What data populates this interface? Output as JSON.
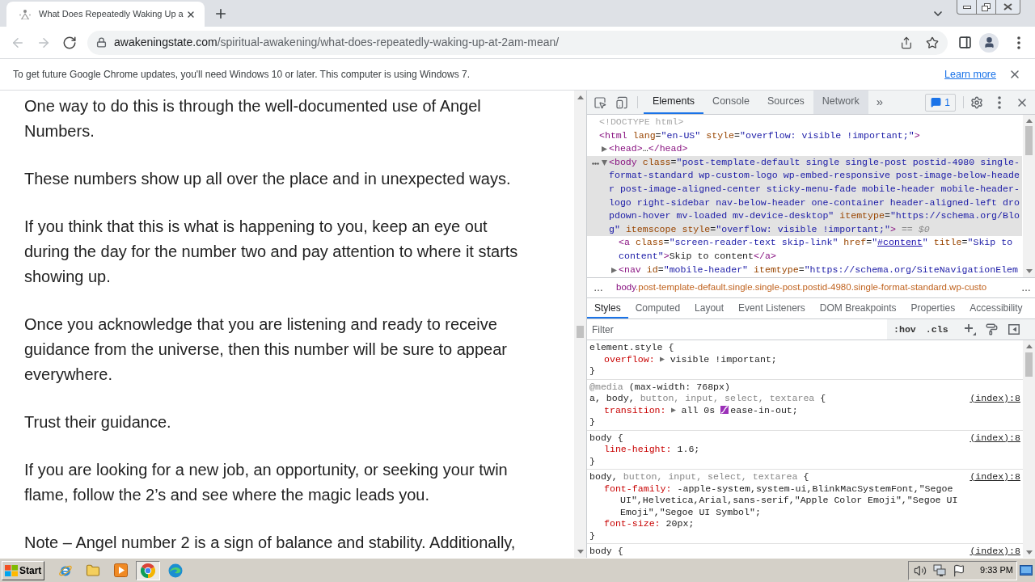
{
  "browser": {
    "tabs": [
      {
        "title": "What Does Repeatedly Waking Up a",
        "selected": true
      }
    ],
    "nav_buttons": [
      {
        "kind": "back",
        "disabled": true
      },
      {
        "kind": "forward",
        "disabled": true
      },
      {
        "kind": "reload",
        "disabled": false
      }
    ],
    "address": {
      "host": "awakeningstate.com",
      "path": "/spiritual-awakening/what-does-repeatedly-waking-up-at-2am-mean/"
    },
    "infobar": {
      "message": "To get future Google Chrome updates, you'll need Windows 10 or later. This computer is using Windows 7.",
      "link": "Learn more"
    }
  },
  "page": {
    "paragraphs": [
      "One way to do this is through the well-documented use of Angel Numbers.",
      "These numbers show up all over the place and in unexpected ways.",
      "If you think that this is what is happening to you, keep an eye out during the day for the number two and pay attention to where it starts showing up.",
      "Once you acknowledge that you are listening and ready to receive guidance from the universe, then this number will be sure to appear everywhere.",
      "Trust their guidance.",
      "If you are looking for a new job, an opportunity, or seeking your twin flame, follow the 2’s and see where the magic leads you.",
      "Note – Angel number 2 is a sign of balance and stability. Additionally,"
    ]
  },
  "devtools": {
    "tabs": [
      {
        "label": "Elements",
        "selected": true,
        "highlighted": false
      },
      {
        "label": "Console",
        "selected": false,
        "highlighted": false
      },
      {
        "label": "Sources",
        "selected": false,
        "highlighted": false
      },
      {
        "label": "Network",
        "selected": false,
        "highlighted": true
      }
    ],
    "more_tabs": "»",
    "issues_count": "1",
    "dom_tree": [
      {
        "segments": [
          {
            "kind": "muted",
            "text": "<!DOCTYPE html>"
          }
        ],
        "selected": false
      },
      {
        "segments": [
          {
            "kind": "tag",
            "text": "<html"
          },
          {
            "kind": "attr",
            "text": " lang"
          },
          {
            "kind": "punct",
            "text": "="
          },
          {
            "kind": "value",
            "text": "\"en-US\""
          },
          {
            "kind": "attr",
            "text": " style"
          },
          {
            "kind": "punct",
            "text": "="
          },
          {
            "kind": "value",
            "text": "\"overflow: visible !important;\""
          },
          {
            "kind": "tag",
            "text": ">"
          }
        ],
        "selected": false,
        "children": [
          {
            "segments": [
              {
                "kind": "tag",
                "text": "<head>"
              },
              {
                "kind": "text",
                "text": "…"
              },
              {
                "kind": "tag",
                "text": "</head>"
              }
            ],
            "selected": false,
            "expanded": false
          },
          {
            "segments": [
              {
                "kind": "tag",
                "text": "<body"
              },
              {
                "kind": "attr",
                "text": " class"
              },
              {
                "kind": "punct",
                "text": "="
              },
              {
                "kind": "value",
                "text": "\"post-template-default single single-post postid-4980 single-format-standard wp-custom-logo wp-embed-responsive post-image-below-header post-image-aligned-center sticky-menu-fade mobile-header mobile-header-logo right-sidebar nav-below-header one-container header-aligned-left dropdown-hover mv-loaded mv-device-desktop\""
              },
              {
                "kind": "attr",
                "text": " itemtype"
              },
              {
                "kind": "punct",
                "text": "="
              },
              {
                "kind": "value",
                "text": "\"https://schema.org/Blog\""
              },
              {
                "kind": "attr",
                "text": " itemscope"
              },
              {
                "kind": "attr",
                "text": " style"
              },
              {
                "kind": "punct",
                "text": "="
              },
              {
                "kind": "value",
                "text": "\"overflow: visible !important;\""
              },
              {
                "kind": "tag",
                "text": ">"
              }
            ],
            "suffix": "== $0",
            "selected": true,
            "expanded": true,
            "children": [
              {
                "segments": [
                  {
                    "kind": "tag",
                    "text": "<a"
                  },
                  {
                    "kind": "attr",
                    "text": " class"
                  },
                  {
                    "kind": "punct",
                    "text": "="
                  },
                  {
                    "kind": "value",
                    "text": "\"screen-reader-text skip-link\""
                  },
                  {
                    "kind": "attr",
                    "text": " href"
                  },
                  {
                    "kind": "punct",
                    "text": "="
                  },
                  {
                    "kind": "value",
                    "text": "\""
                  },
                  {
                    "kind": "link",
                    "text": "#content"
                  },
                  {
                    "kind": "value",
                    "text": "\""
                  },
                  {
                    "kind": "attr",
                    "text": " title"
                  },
                  {
                    "kind": "punct",
                    "text": "="
                  },
                  {
                    "kind": "value",
                    "text": "\"Skip to content\""
                  },
                  {
                    "kind": "tag",
                    "text": ">"
                  },
                  {
                    "kind": "text",
                    "text": "Skip to content"
                  },
                  {
                    "kind": "tag",
                    "text": "</a>"
                  }
                ],
                "selected": false
              },
              {
                "segments": [
                  {
                    "kind": "tag",
                    "text": "<nav"
                  },
                  {
                    "kind": "attr",
                    "text": " id"
                  },
                  {
                    "kind": "punct",
                    "text": "="
                  },
                  {
                    "kind": "value",
                    "text": "\"mobile-header\""
                  },
                  {
                    "kind": "attr",
                    "text": " itemtype"
                  },
                  {
                    "kind": "punct",
                    "text": "="
                  },
                  {
                    "kind": "value",
                    "text": "\"https://schema.org/SiteNavigationElem"
                  }
                ],
                "selected": false,
                "expanded": false
              }
            ]
          }
        ]
      }
    ],
    "breadcrumb": {
      "start": "…",
      "element": "body",
      "classes": ".post-template-default.single.single-post.postid-4980.single-format-standard.wp-custo",
      "end": "…"
    },
    "sidebar_tabs": [
      {
        "label": "Styles",
        "selected": true
      },
      {
        "label": "Computed",
        "selected": false
      },
      {
        "label": "Layout",
        "selected": false
      },
      {
        "label": "Event Listeners",
        "selected": false
      },
      {
        "label": "DOM Breakpoints",
        "selected": false
      },
      {
        "label": "Properties",
        "selected": false
      },
      {
        "label": "Accessibility",
        "selected": false
      }
    ],
    "filter": {
      "placeholder": "Filter",
      "toggles": [
        ":hov",
        ".cls"
      ]
    },
    "rules": [
      {
        "selector": [
          {
            "text": "element.style",
            "matched": true
          },
          {
            "text": " {",
            "matched": true
          }
        ],
        "declarations": [
          {
            "name": "overflow:",
            "expandable": true,
            "parts": [
              {
                "kind": "text",
                "text": "visible !important;"
              }
            ]
          }
        ],
        "close": "}"
      },
      {
        "media": {
          "keyword": "@media",
          "query": "(max-width: 768px)"
        },
        "selector": [
          {
            "text": "a, body, ",
            "matched": true
          },
          {
            "text": "button, input, select, textarea",
            "matched": false
          },
          {
            "text": " {",
            "matched": true
          }
        ],
        "source": "(index):8",
        "declarations": [
          {
            "name": "transition:",
            "expandable": true,
            "parts": [
              {
                "kind": "text",
                "text": "all 0s"
              },
              {
                "kind": "easing_swatch"
              },
              {
                "kind": "text",
                "text": "ease-in-out;"
              }
            ]
          }
        ],
        "close": "}"
      },
      {
        "selector": [
          {
            "text": "body {",
            "matched": true
          }
        ],
        "source": "(index):8",
        "declarations": [
          {
            "name": "line-height:",
            "expandable": false,
            "parts": [
              {
                "kind": "text",
                "text": "1.6;"
              }
            ]
          }
        ],
        "close": "}"
      },
      {
        "selector": [
          {
            "text": "body, ",
            "matched": true
          },
          {
            "text": "button, input, select, textarea",
            "matched": false
          },
          {
            "text": " {",
            "matched": true
          }
        ],
        "source": "(index):8",
        "declarations": [
          {
            "name": "font-family:",
            "expandable": false,
            "parts": [
              {
                "kind": "text",
                "text": "-apple-system,system-ui,BlinkMacSystemFont,\"Segoe UI\",Helvetica,Arial,sans-serif,\"Apple Color Emoji\",\"Segoe UI Emoji\",\"Segoe UI Symbol\";"
              }
            ]
          },
          {
            "name": "font-size:",
            "expandable": false,
            "parts": [
              {
                "kind": "text",
                "text": "20px;"
              }
            ]
          }
        ],
        "close": "}"
      },
      {
        "selector": [
          {
            "text": "body {",
            "matched": true
          }
        ],
        "source": "(index):8"
      }
    ]
  },
  "taskbar": {
    "start": "Start",
    "apps": [
      {
        "kind": "ie",
        "active": false
      },
      {
        "kind": "explorer",
        "active": false
      },
      {
        "kind": "media",
        "active": false
      },
      {
        "kind": "chrome",
        "active": true
      },
      {
        "kind": "edge",
        "active": false
      }
    ],
    "clock": "9:33 PM"
  }
}
